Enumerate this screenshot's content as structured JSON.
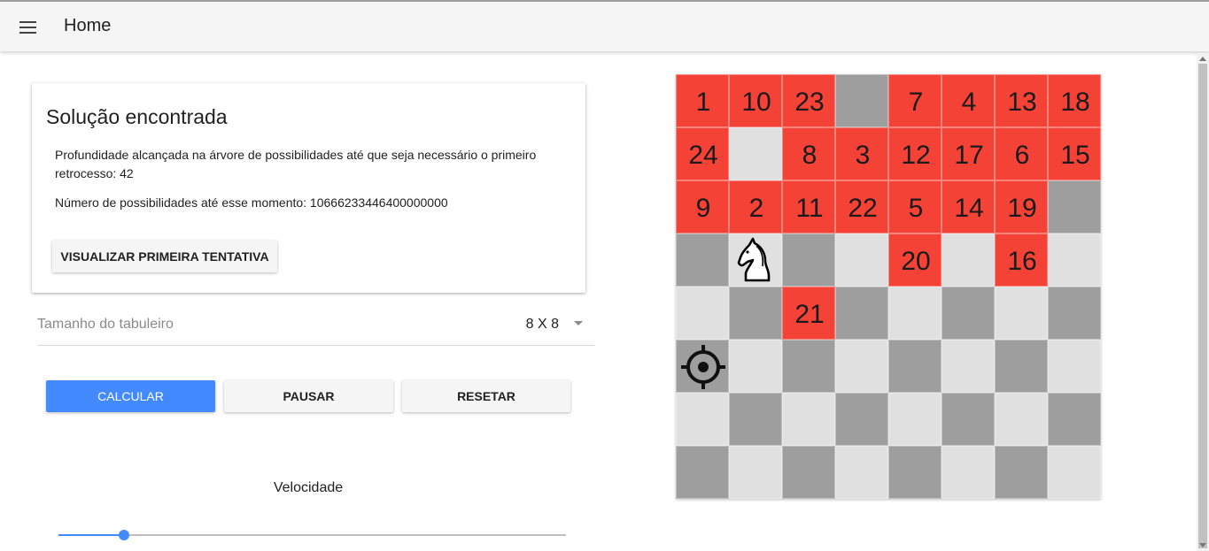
{
  "header": {
    "title": "Home",
    "menu_icon": "hamburger-menu-icon"
  },
  "card": {
    "title": "Solução encontrada",
    "depth_text": "Profundidade alcançada na árvore de possibilidades até que seja necessário o primeiro retrocesso: 42",
    "possibilities_text": "Número de possibilidades até esse momento: 10666233446400000000",
    "visualize_button": "VISUALIZAR PRIMEIRA TENTATIVA"
  },
  "board_size_select": {
    "label": "Tamanho do tabuleiro",
    "value": "8 X 8"
  },
  "actions": {
    "calcular": "CALCULAR",
    "pausar": "PAUSAR",
    "resetar": "RESETAR"
  },
  "speed": {
    "label": "Velocidade",
    "value_fraction": 0.13
  },
  "colors": {
    "primary": "#448aff",
    "visited": "#f44336",
    "light_square": "#e0e0e0",
    "dark_square": "#9e9e9e"
  },
  "board": {
    "size": 8,
    "rows": [
      [
        "1",
        "10",
        "23",
        "",
        "7",
        "4",
        "13",
        "18"
      ],
      [
        "24",
        "",
        "8",
        "3",
        "12",
        "17",
        "6",
        "15"
      ],
      [
        "9",
        "2",
        "11",
        "22",
        "5",
        "14",
        "19",
        ""
      ],
      [
        "",
        "knight",
        "",
        "",
        "20",
        "",
        "16",
        ""
      ],
      [
        "",
        "",
        "21",
        "",
        "",
        "",
        "",
        ""
      ],
      [
        "target",
        "",
        "",
        "",
        "",
        "",
        "",
        ""
      ],
      [
        "",
        "",
        "",
        "",
        "",
        "",
        "",
        ""
      ],
      [
        "",
        "",
        "",
        "",
        "",
        "",
        "",
        ""
      ]
    ],
    "knight_icon": "knight-icon",
    "target_icon": "crosshair-icon"
  }
}
